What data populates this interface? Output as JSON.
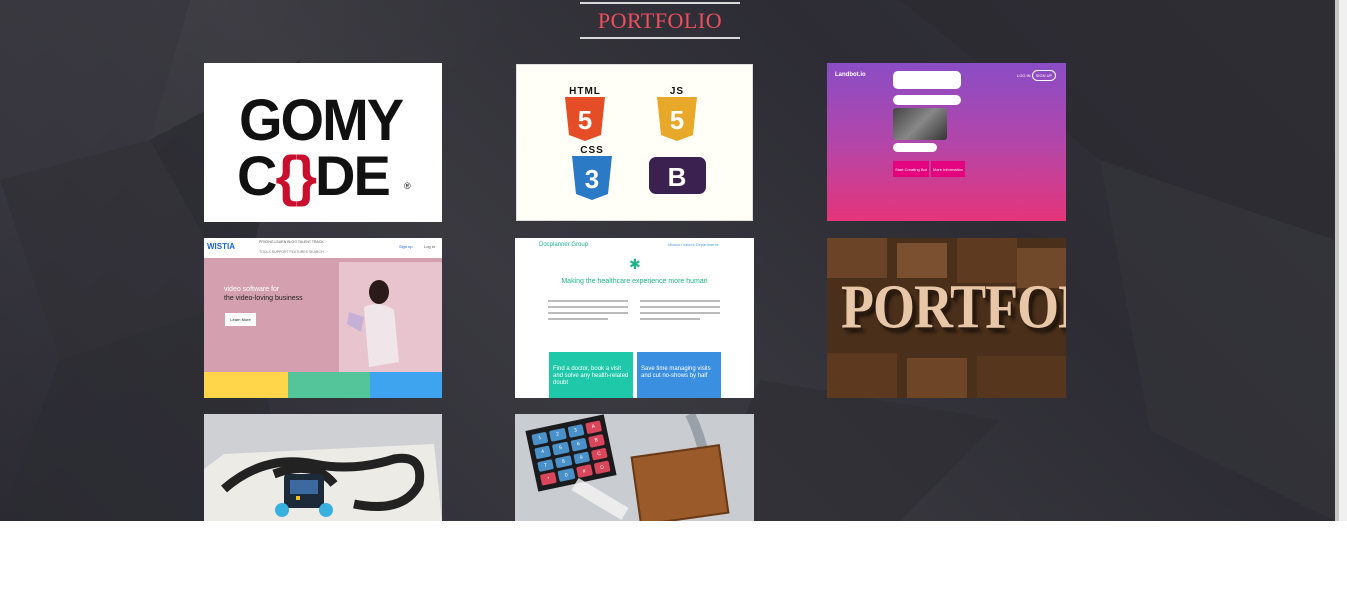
{
  "section": {
    "title": "PORTFOLIO"
  },
  "colors": {
    "title": "#ee4f5f",
    "background": "#302f37"
  },
  "cards": [
    {
      "name": "gomycode",
      "logo_top": "GOMY",
      "logo_bottom_left": "C",
      "logo_bottom_brace": "{}",
      "logo_bottom_right": "DE",
      "reg": "®"
    },
    {
      "name": "web-technologies",
      "badges": [
        {
          "label": "HTML",
          "num": "5",
          "color": "#e44d26"
        },
        {
          "label": "JS",
          "num": "5",
          "color": "#e8a82a"
        },
        {
          "label": "CSS",
          "num": "3",
          "color": "#2a7ac6"
        },
        {
          "label": "",
          "num": "B",
          "color": "#563d7c"
        }
      ]
    },
    {
      "name": "landbot",
      "logo": "Landbot.io",
      "login": "LOG IN",
      "signup": "SIGN UP",
      "btn1": "Start Creating Bot",
      "btn2": "More Information"
    },
    {
      "name": "wistia",
      "logo": "WISTIA",
      "nav1": "PRICING   LEARN   BLOG   TALENT   TRACK",
      "nav2": "TOOLS   SUPPORT   FEATURES   SEARCH",
      "signup": "Sign up",
      "login": "Log in",
      "tagline1": "video software for",
      "tagline2": "the video-loving business",
      "cta": "Learn More"
    },
    {
      "name": "docplanner",
      "logo": "Docplanner Group",
      "nav": "Mission   Values   Departments",
      "heading": "Making the healthcare experience more human",
      "box1": "Find a doctor, book a visit and solve any health-related doubt",
      "box2": "Save time managing visits and cut no-shows by half"
    },
    {
      "name": "portfolio-letterpress",
      "text": "PORTFOLIO"
    },
    {
      "name": "line-follower-robot"
    },
    {
      "name": "arduino-keypad",
      "keys": [
        "1",
        "2",
        "3",
        "A",
        "4",
        "5",
        "6",
        "B",
        "7",
        "8",
        "9",
        "C",
        "*",
        "0",
        "#",
        "D"
      ]
    }
  ]
}
